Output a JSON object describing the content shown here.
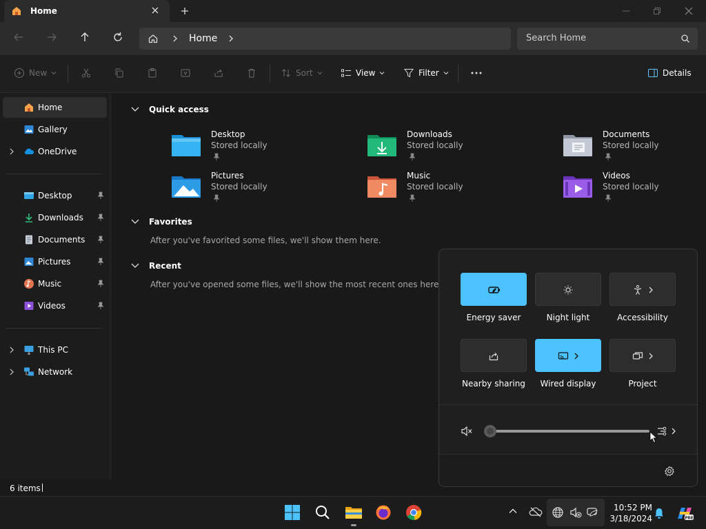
{
  "window": {
    "tab_title": "Home",
    "new_tab_glyph": "+"
  },
  "address": {
    "crumb": "Home",
    "search_placeholder": "Search Home"
  },
  "toolbar": {
    "new_label": "New",
    "sort_label": "Sort",
    "view_label": "View",
    "filter_label": "Filter",
    "details_label": "Details"
  },
  "sidebar": {
    "items": [
      {
        "label": "Home",
        "icon": "home-icon",
        "selected": true
      },
      {
        "label": "Gallery",
        "icon": "gallery-icon"
      },
      {
        "label": "OneDrive",
        "icon": "onedrive-icon"
      },
      {
        "label": "Desktop",
        "icon": "desktop-folder-icon",
        "pinned": true
      },
      {
        "label": "Downloads",
        "icon": "downloads-icon",
        "pinned": true
      },
      {
        "label": "Documents",
        "icon": "documents-icon",
        "pinned": true
      },
      {
        "label": "Pictures",
        "icon": "pictures-icon",
        "pinned": true
      },
      {
        "label": "Music",
        "icon": "music-icon",
        "pinned": true
      },
      {
        "label": "Videos",
        "icon": "videos-icon",
        "pinned": true
      },
      {
        "label": "This PC",
        "icon": "this-pc-icon"
      },
      {
        "label": "Network",
        "icon": "network-icon"
      }
    ]
  },
  "content": {
    "quick_access": {
      "title": "Quick access",
      "items": [
        {
          "name": "Desktop",
          "sub": "Stored locally"
        },
        {
          "name": "Downloads",
          "sub": "Stored locally"
        },
        {
          "name": "Documents",
          "sub": "Stored locally"
        },
        {
          "name": "Pictures",
          "sub": "Stored locally"
        },
        {
          "name": "Music",
          "sub": "Stored locally"
        },
        {
          "name": "Videos",
          "sub": "Stored locally"
        }
      ]
    },
    "favorites": {
      "title": "Favorites",
      "message": "After you've favorited some files, we'll show them here."
    },
    "recent": {
      "title": "Recent",
      "message": "After you've opened some files, we'll show the most recent ones here."
    }
  },
  "status": {
    "items_count": "6 items"
  },
  "quick_settings": {
    "tiles": [
      {
        "label": "Energy saver",
        "active": true,
        "icon": "energy-saver-icon"
      },
      {
        "label": "Night light",
        "active": false,
        "icon": "night-light-icon"
      },
      {
        "label": "Accessibility",
        "active": false,
        "icon": "accessibility-icon"
      },
      {
        "label": "Nearby sharing",
        "active": false,
        "icon": "nearby-sharing-icon"
      },
      {
        "label": "Wired display",
        "active": true,
        "icon": "wired-display-icon"
      },
      {
        "label": "Project",
        "active": false,
        "icon": "project-icon"
      }
    ],
    "volume_level": 0
  },
  "taskbar": {
    "time": "10:52 PM",
    "date": "3/18/2024"
  },
  "colors": {
    "accent": "#4cc2ff",
    "background": "#191919",
    "sidebar_selected": "#2d2d2d"
  }
}
